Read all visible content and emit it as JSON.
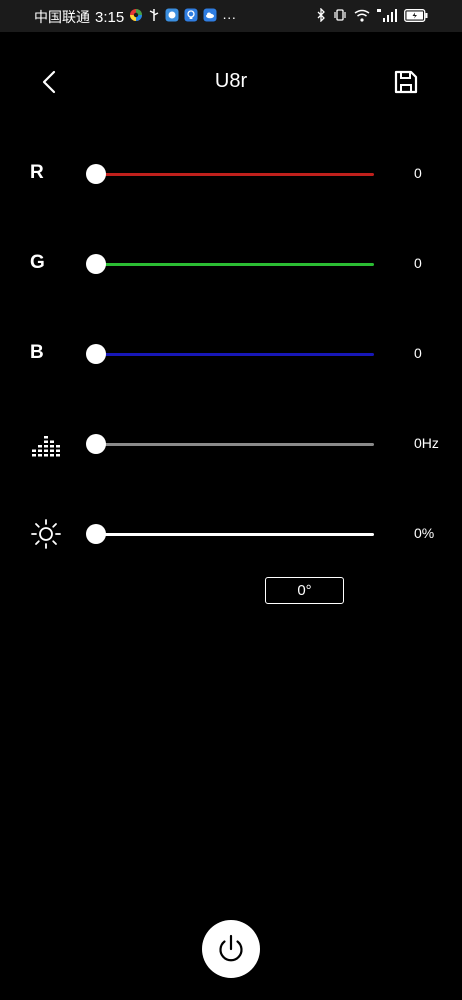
{
  "status_bar": {
    "carrier": "中国联通",
    "time": "3:15",
    "more": "···"
  },
  "header": {
    "title": "U8r",
    "back_icon": "chevron-left-icon",
    "save_icon": "save-icon"
  },
  "sliders": [
    {
      "label": "R",
      "value": "0",
      "track_color": "#c0201c",
      "level": 0
    },
    {
      "label": "G",
      "value": "0",
      "track_color": "#2bbd33",
      "level": 0
    },
    {
      "label": "B",
      "value": "0",
      "track_color": "#1717b8",
      "level": 0
    },
    {
      "label": "",
      "icon": "equalizer-icon",
      "value": "0Hz",
      "track_color": "#8a8a8a",
      "level": 0
    },
    {
      "label": "",
      "icon": "brightness-icon",
      "value": "0%",
      "track_color": "#ffffff",
      "level": 0
    }
  ],
  "angle": {
    "value": "0°"
  },
  "power": {
    "icon": "power-icon"
  }
}
